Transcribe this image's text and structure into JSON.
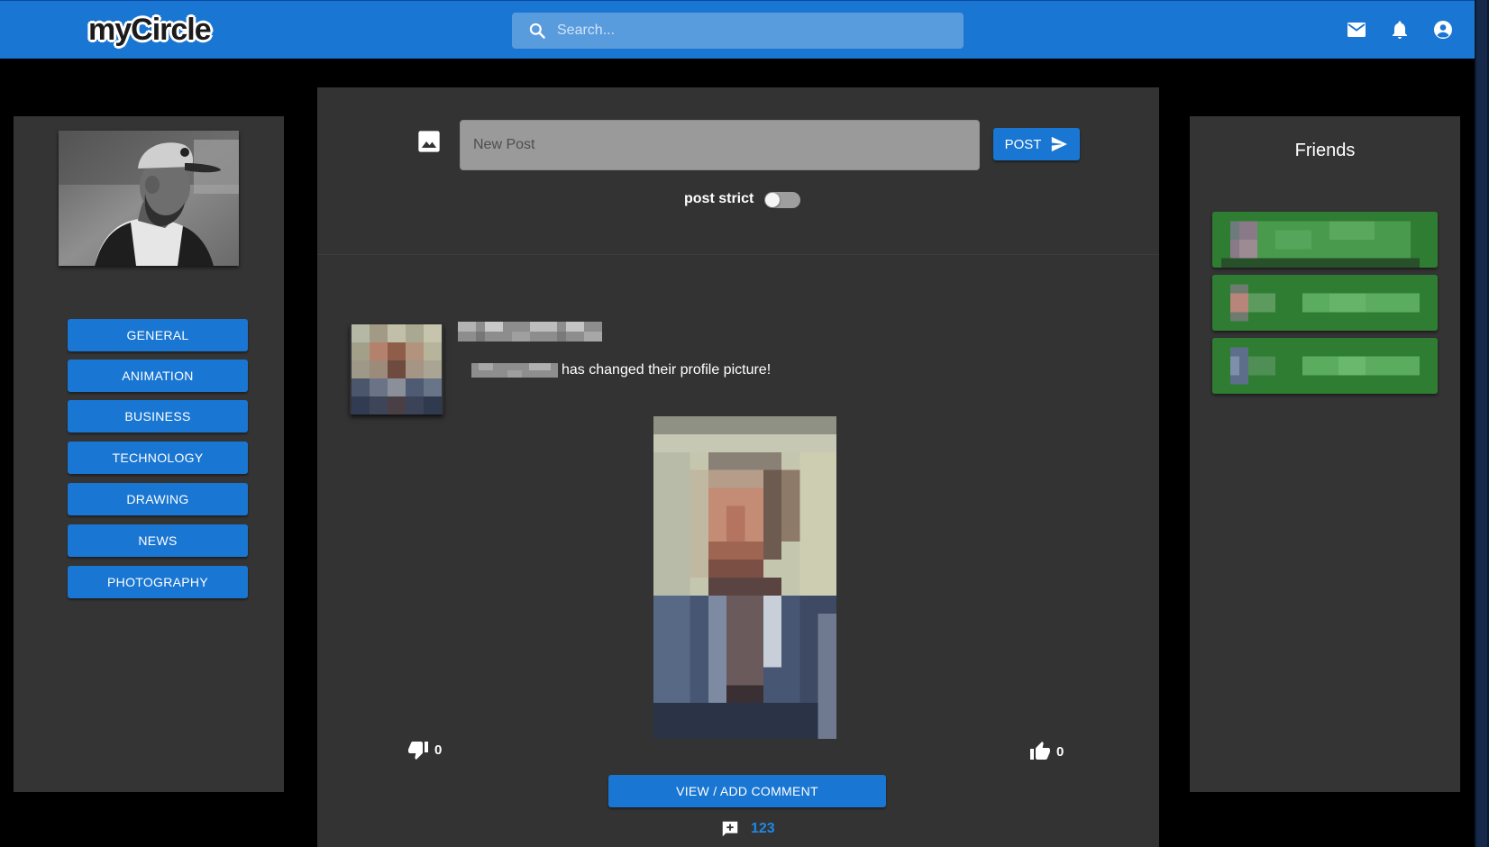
{
  "app": {
    "logo": "myCircle"
  },
  "search": {
    "placeholder": "Search..."
  },
  "topbar_icons": [
    "mail-icon",
    "bell-icon",
    "account-circle-icon"
  ],
  "categories": [
    "GENERAL",
    "ANIMATION",
    "BUSINESS",
    "TECHNOLOGY",
    "DRAWING",
    "NEWS",
    "PHOTOGRAPHY"
  ],
  "composer": {
    "placeholder": "New Post",
    "post_label": "POST",
    "strict_label": "post strict",
    "strict_enabled": false
  },
  "post": {
    "text": "has changed their profile picture!",
    "dislikes": "0",
    "likes": "0",
    "comment_button": "VIEW / ADD COMMENT",
    "comment_count": "123"
  },
  "friends": {
    "title": "Friends",
    "count_visible": 3
  },
  "colors": {
    "primary": "#1976d2",
    "panel": "#343434",
    "friend_card": "#2e7d32",
    "background": "#000000"
  }
}
